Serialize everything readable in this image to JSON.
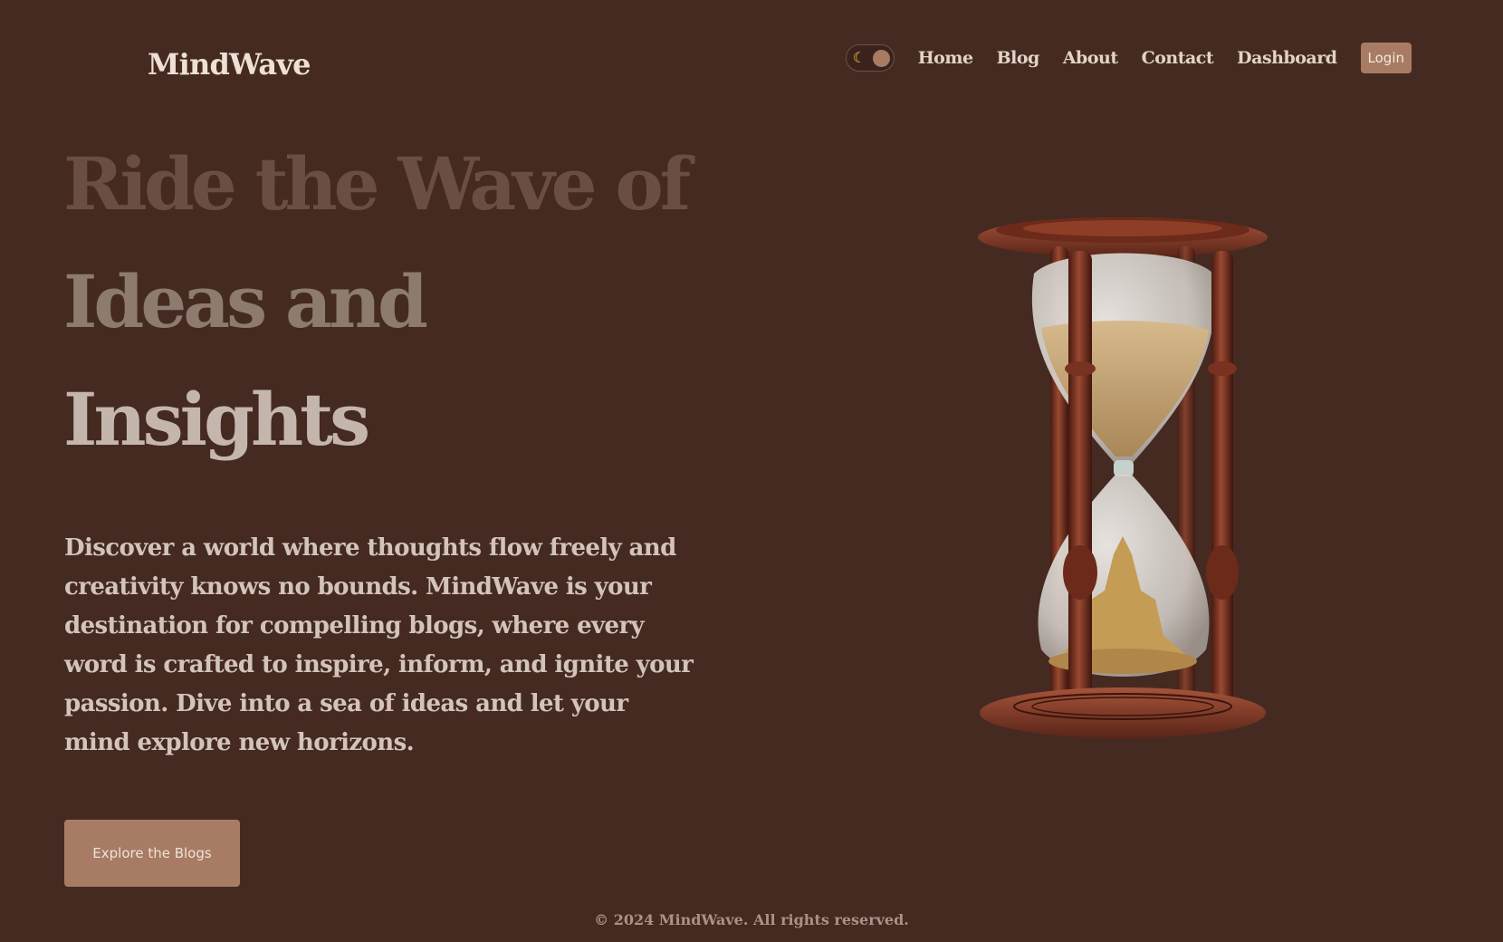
{
  "brand": {
    "name": "MindWave"
  },
  "nav": {
    "theme_toggle_icon": "moon-icon",
    "links": [
      {
        "label": "Home"
      },
      {
        "label": "Blog"
      },
      {
        "label": "About"
      },
      {
        "label": "Contact"
      },
      {
        "label": "Dashboard"
      }
    ],
    "login_label": "Login"
  },
  "hero": {
    "title_lines": [
      "Ride the Wave of",
      "Ideas and",
      "Insights"
    ],
    "description": "Discover a world where thoughts flow freely and creativity knows no bounds. MindWave is your destination for compelling blogs, where every word is crafted to inspire, inform, and ignite your passion. Dive into a sea of ideas and let your mind explore new horizons.",
    "cta_label": "Explore the Blogs",
    "image": "hourglass-illustration"
  },
  "footer": {
    "text": "© 2024 MindWave. All rights reserved."
  },
  "colors": {
    "background": "#452a22",
    "accent": "#a87c64"
  }
}
